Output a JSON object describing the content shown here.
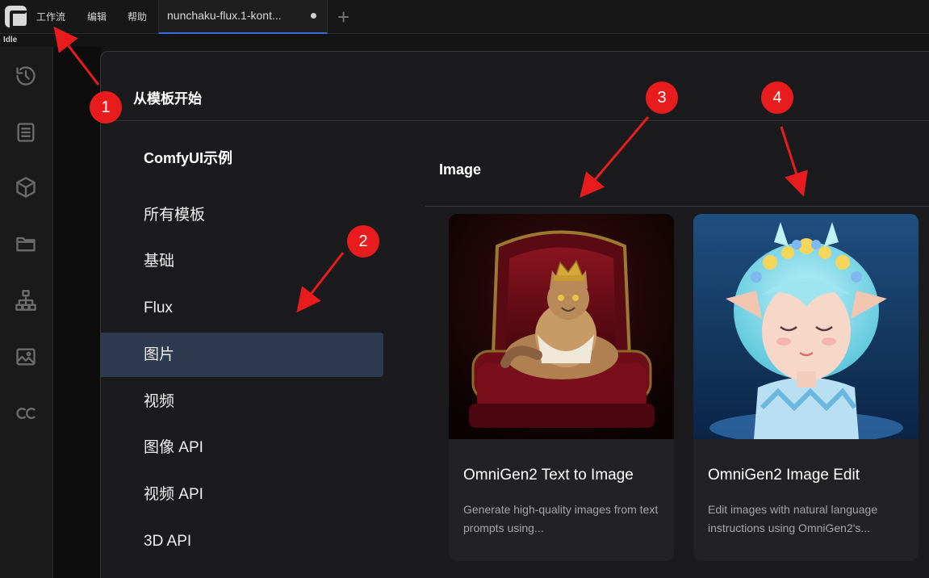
{
  "menu": {
    "workflow": "工作流",
    "edit": "编辑",
    "help": "帮助"
  },
  "tab": {
    "title": "nunchaku-flux.1-kont..."
  },
  "status": "Idle",
  "dialog": {
    "title": "从模板开始",
    "nav_heading": "ComfyUI示例",
    "nav_items": [
      "所有模板",
      "基础",
      "Flux",
      "图片",
      "视频",
      "图像 API",
      "视频 API",
      "3D API"
    ],
    "active_item": "图片",
    "section_title": "Image",
    "cards": [
      {
        "title": "OmniGen2 Text to Image",
        "description": "Generate high-quality images from text prompts using..."
      },
      {
        "title": "OmniGen2 Image Edit",
        "description": "Edit images with natural language instructions using OmniGen2's..."
      }
    ]
  },
  "annotations": [
    "1",
    "2",
    "3",
    "4"
  ],
  "colors": {
    "accent": "#3b6bd4",
    "active_nav": "#2d3a50",
    "annotation": "#e81c1c"
  }
}
